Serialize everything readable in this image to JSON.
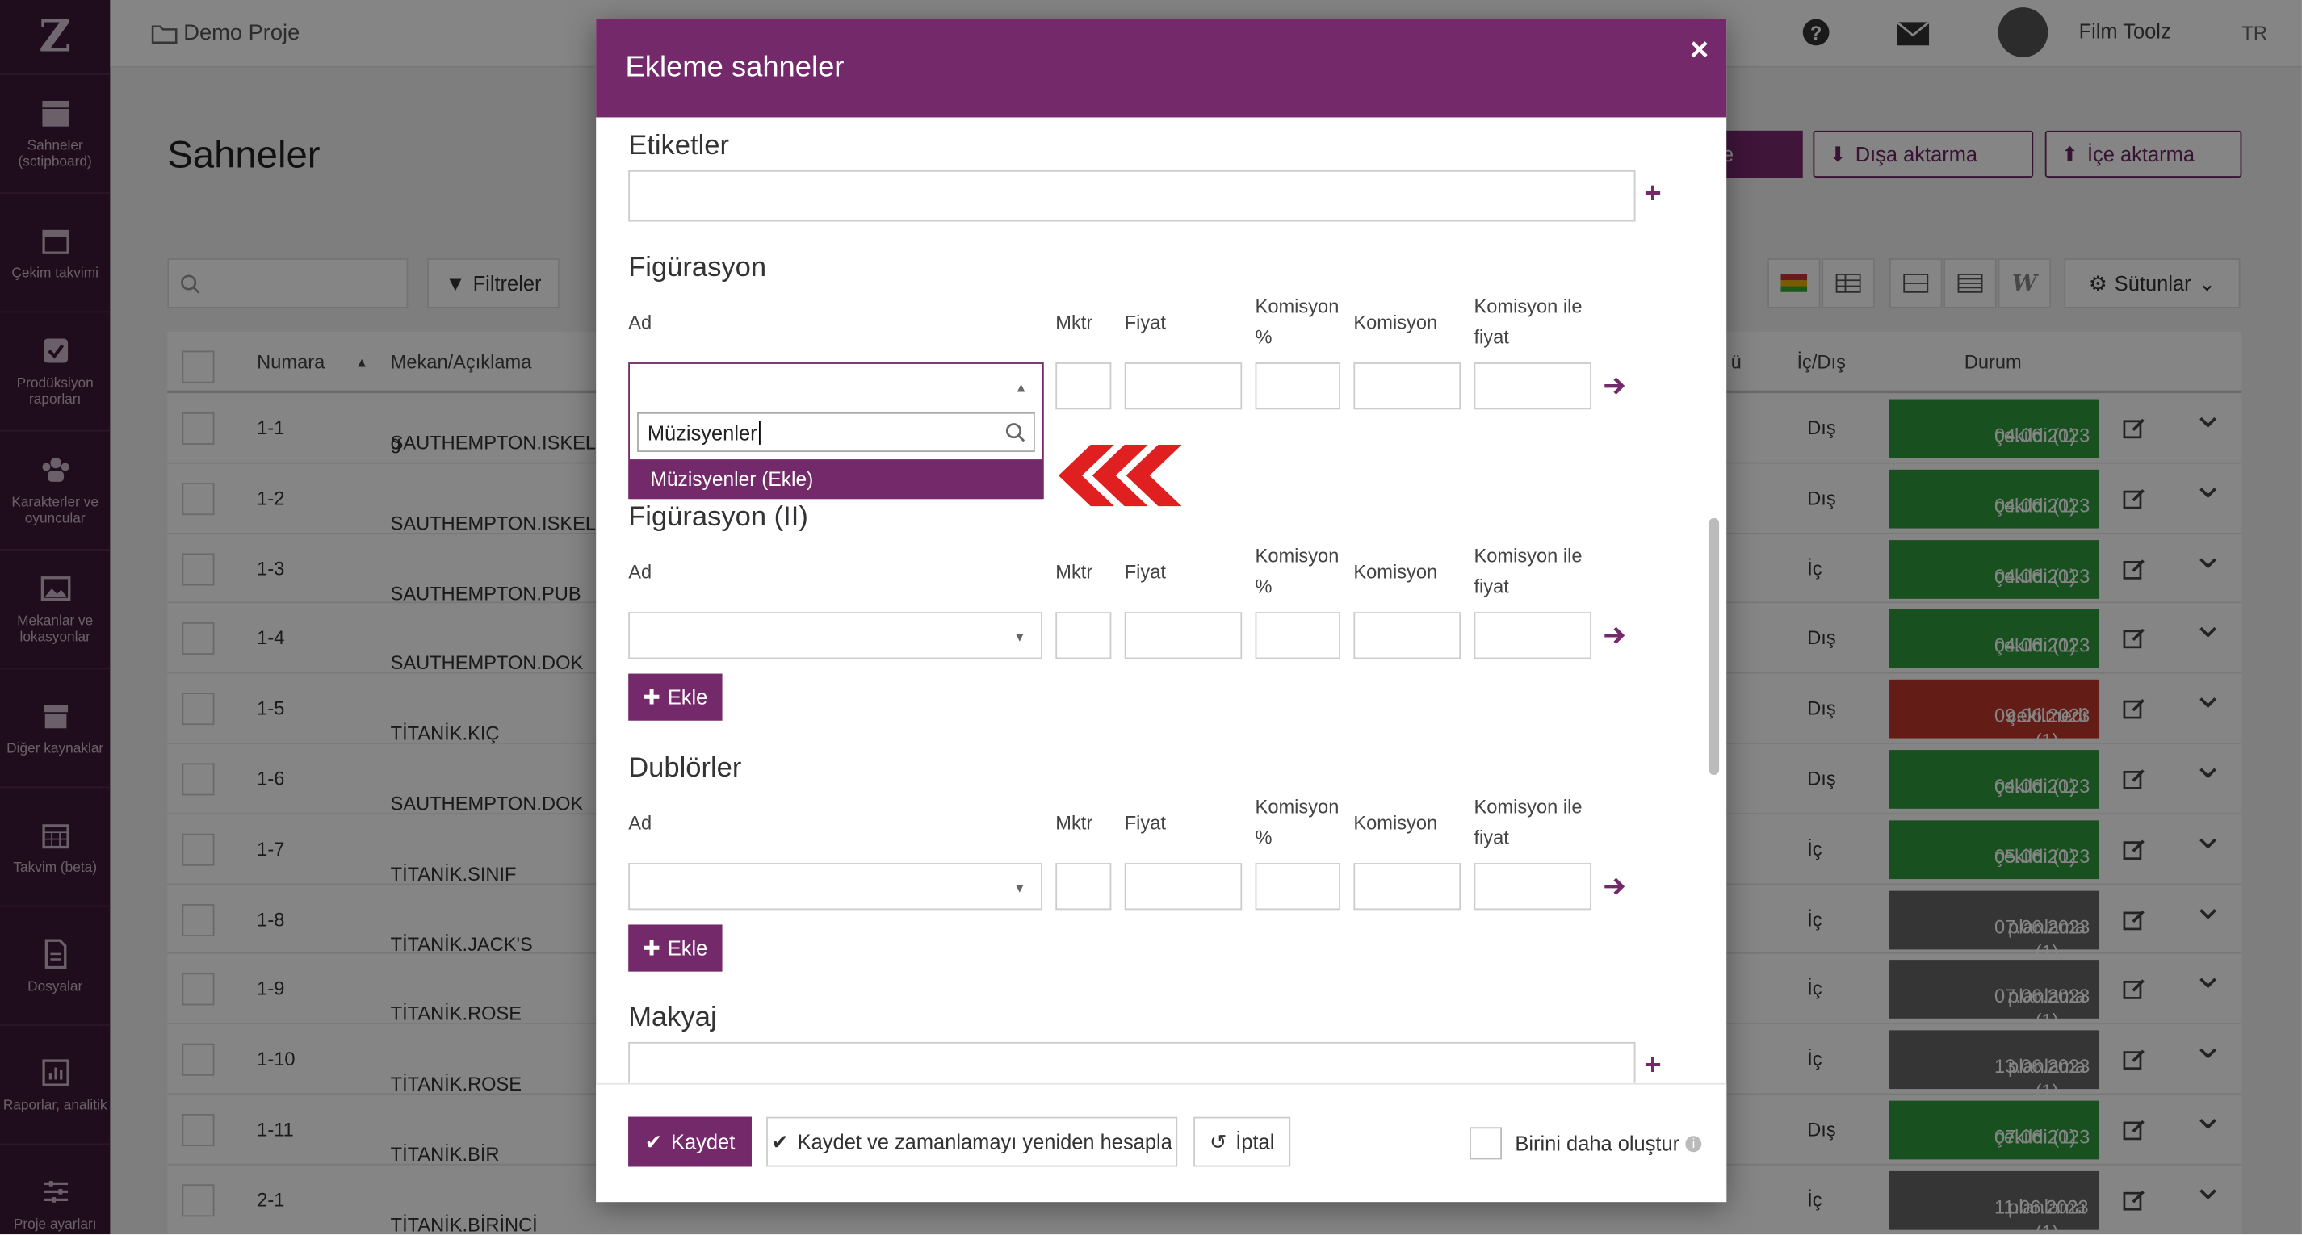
{
  "sidebar": {
    "logo": "Z",
    "items": [
      {
        "label": "Sahneler (sctipboard)",
        "icon": "clapperboard-icon"
      },
      {
        "label": "Çekim takvimi",
        "icon": "calendar-icon"
      },
      {
        "label": "Prodüksiyon raporları",
        "icon": "checkbox-icon"
      },
      {
        "label": "Karakterler ve oyuncular",
        "icon": "people-icon"
      },
      {
        "label": "Mekanlar ve lokasyonlar",
        "icon": "image-icon"
      },
      {
        "label": "Diğer kaynaklar",
        "icon": "box-icon"
      },
      {
        "label": "Takvim (beta)",
        "icon": "calendar-grid-icon"
      },
      {
        "label": "Dosyalar",
        "icon": "file-icon"
      },
      {
        "label": "Raporlar, analitik",
        "icon": "bar-chart-icon"
      },
      {
        "label": "Proje ayarları",
        "icon": "sliders-icon"
      }
    ]
  },
  "topbar": {
    "project": "Demo Proje",
    "user": "Film Toolz",
    "lang": "TR"
  },
  "page": {
    "title": "Sahneler",
    "add_label": "le",
    "export_label": "Dışa aktarma",
    "import_label": "İçe aktarma",
    "filters_label": "Filtreler",
    "columns_label": "Sütunlar"
  },
  "table": {
    "headers": {
      "number": "Numara",
      "location": "Mekan/Açıklama",
      "col_u": "ü",
      "inout": "İç/Dış",
      "status": "Durum"
    },
    "rows": [
      {
        "num": "1-1",
        "loc": "SAUTHEMPTON.ISKELE",
        "loc2": "g",
        "inout": "Dış",
        "s1": "çekildi (1)",
        "s2": "04.06.2023",
        "color": "green"
      },
      {
        "num": "1-2",
        "loc": "SAUTHEMPTON.ISKELE",
        "loc2": "",
        "inout": "Dış",
        "s1": "çekildi (1)",
        "s2": "04.06.2023",
        "color": "green"
      },
      {
        "num": "1-3",
        "loc": "SAUTHEMPTON.PUB",
        "loc2": "",
        "inout": "İç",
        "s1": "çekildi (1)",
        "s2": "04.06.2023",
        "color": "green"
      },
      {
        "num": "1-4",
        "loc": "SAUTHEMPTON.DOK",
        "loc2": "",
        "inout": "Dış",
        "s1": "çekildi (1)",
        "s2": "04.06.2023",
        "color": "green"
      },
      {
        "num": "1-5",
        "loc": "TİTANİK.KIÇ GÜVERTE",
        "loc2": "",
        "inout": "Dış",
        "s1": "çekilmedi (1)",
        "s2": "09.06.2023",
        "color": "red"
      },
      {
        "num": "1-6",
        "loc": "SAUTHEMPTON.DOK",
        "loc2": "",
        "inout": "Dış",
        "s1": "çekildi (1)",
        "s2": "04.06.2023",
        "color": "green"
      },
      {
        "num": "1-7",
        "loc": "TİTANİK.SINIF YATAKLA",
        "loc2": "",
        "inout": "İç",
        "s1": "çekildi (1)",
        "s2": "05.06.2023",
        "color": "green"
      },
      {
        "num": "1-8",
        "loc": "TİTANİK.JACK'S SÜİT",
        "loc2": "",
        "inout": "İç",
        "s1": "planlama (1)",
        "s2": "07.06.2023",
        "color": "gray"
      },
      {
        "num": "1-9",
        "loc": "TİTANİK.ROSE VE CAL'IN",
        "loc2": "",
        "inout": "İç",
        "s1": "planlama (1)",
        "s2": "07.06.2023",
        "color": "gray"
      },
      {
        "num": "1-10",
        "loc": "TİTANİK.ROSE VE CAL'IN",
        "loc2": "",
        "inout": "İç",
        "s1": "planlama (1)",
        "s2": "13.06.2023",
        "color": "gray"
      },
      {
        "num": "1-11",
        "loc": "TİTANİK.BİR GÜVERTED",
        "loc2": "",
        "inout": "Dış",
        "s1": "çekildi (1)",
        "s2": "07.06.2023",
        "color": "green"
      },
      {
        "num": "2-1",
        "loc": "TİTANİK.BİRİNCİ SINIF RESEPSİYON",
        "loc2": "",
        "inout": "İç",
        "s1": "planlama (1)",
        "s2": "11.06.2023",
        "color": "gray"
      }
    ]
  },
  "modal": {
    "title": "Ekleme sahneler",
    "close": "×",
    "tags_title": "Etiketler",
    "col_labels": {
      "name": "Ad",
      "qty": "Mktr",
      "price": "Fiyat",
      "comm_pct_a": "Komisyon",
      "comm_pct_b": "%",
      "comm": "Komisyon",
      "comm_price_a": "Komisyon ile",
      "comm_price_b": "fiyat"
    },
    "sec_extras": "Figürasyon",
    "sec_extras2": "Figürasyon (II)",
    "sec_stunts": "Dublörler",
    "sec_makeup": "Makyaj",
    "add_label": "Ekle",
    "dropdown": {
      "search_value": "Müzisyenler",
      "option": "Müzisyenler (Ekle)"
    }
  },
  "footer": {
    "save": "Kaydet",
    "save_reschedule": "Kaydet ve zamanlamayı yeniden hesapla",
    "cancel": "İptal",
    "create_another": "Birini daha oluştur"
  }
}
